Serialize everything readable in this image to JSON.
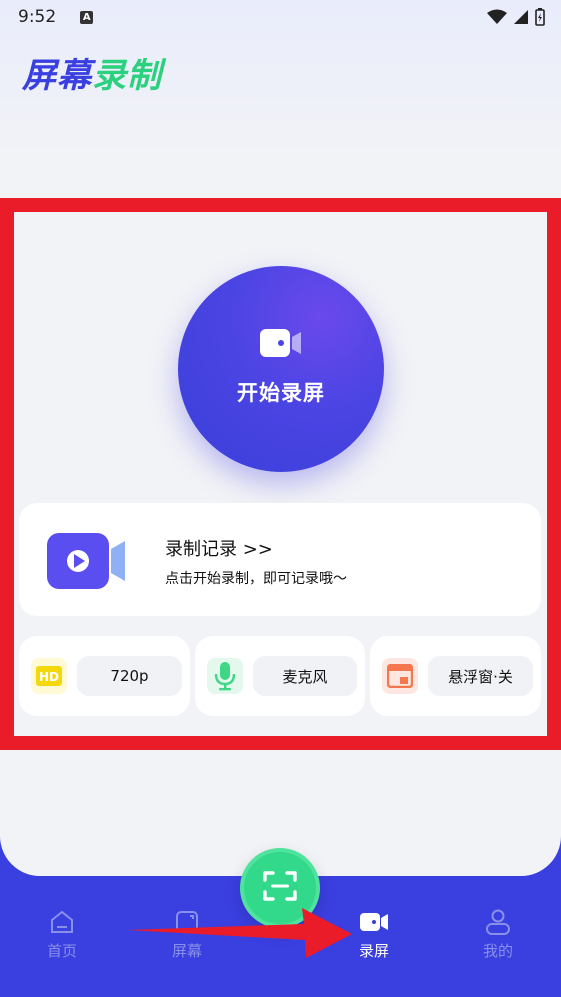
{
  "status_bar": {
    "time": "9:52",
    "notification_icon": "A"
  },
  "app_title": {
    "part1": "屏幕",
    "part2": "录制"
  },
  "record_button": {
    "label": "开始录屏",
    "icon": "video-camera-icon"
  },
  "history": {
    "title": "录制记录 >>",
    "subtitle": "点击开始录制，即可记录哦～",
    "icon": "play-video-icon"
  },
  "options": [
    {
      "icon": "hd-icon",
      "badge": "HD",
      "label": "720p"
    },
    {
      "icon": "microphone-icon",
      "label": "麦克风"
    },
    {
      "icon": "floating-window-icon",
      "label": "悬浮窗·关"
    }
  ],
  "bottom_nav": {
    "items": [
      {
        "label": "首页",
        "icon": "home-icon"
      },
      {
        "label": "屏幕",
        "icon": "screen-icon"
      },
      {
        "label": "录屏",
        "icon": "camera-icon",
        "active": true
      },
      {
        "label": "我的",
        "icon": "profile-icon"
      }
    ],
    "fab_icon": "scan-icon"
  },
  "colors": {
    "primary": "#3a3fe0",
    "accent_green": "#2bd17e",
    "highlight_red": "#ea1c2a"
  }
}
